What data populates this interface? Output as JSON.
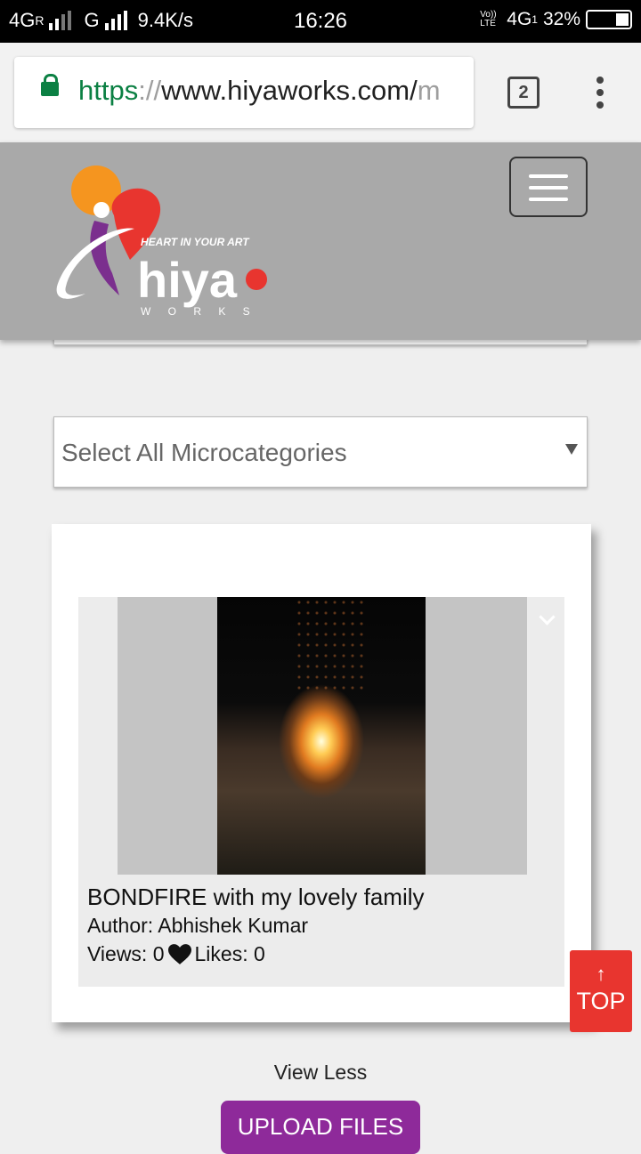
{
  "status_bar": {
    "network_left": "4G",
    "roaming": "R",
    "network_second": "G",
    "speed": "9.4K/s",
    "time": "16:26",
    "volte": "Vo)) LTE",
    "network_right": "4G",
    "sim": "1",
    "battery": "32%"
  },
  "browser": {
    "url_scheme": "https",
    "url_separator": "://",
    "url_host": "www.hiyaworks.com/",
    "url_rest": "m",
    "tab_count": "2"
  },
  "site": {
    "logo_tagline": "HEART IN YOUR ART",
    "logo_word": "hiya",
    "logo_sub": "W O R K S"
  },
  "filters": {
    "microcategory_select": "Select All Microcategories"
  },
  "post": {
    "title": "BONDFIRE with my lovely family",
    "author": "Author: Abhishek Kumar",
    "views": "Views: 0",
    "likes": "Likes: 0"
  },
  "buttons": {
    "top_arrow": "↑",
    "top_label": "TOP",
    "view_less": "View Less",
    "upload": "UPLOAD FILES"
  },
  "colors": {
    "header_bg": "#a9a9a9",
    "top_button": "#e8352f",
    "upload_button": "#8e2a9a",
    "secure_green": "#0b8043"
  }
}
